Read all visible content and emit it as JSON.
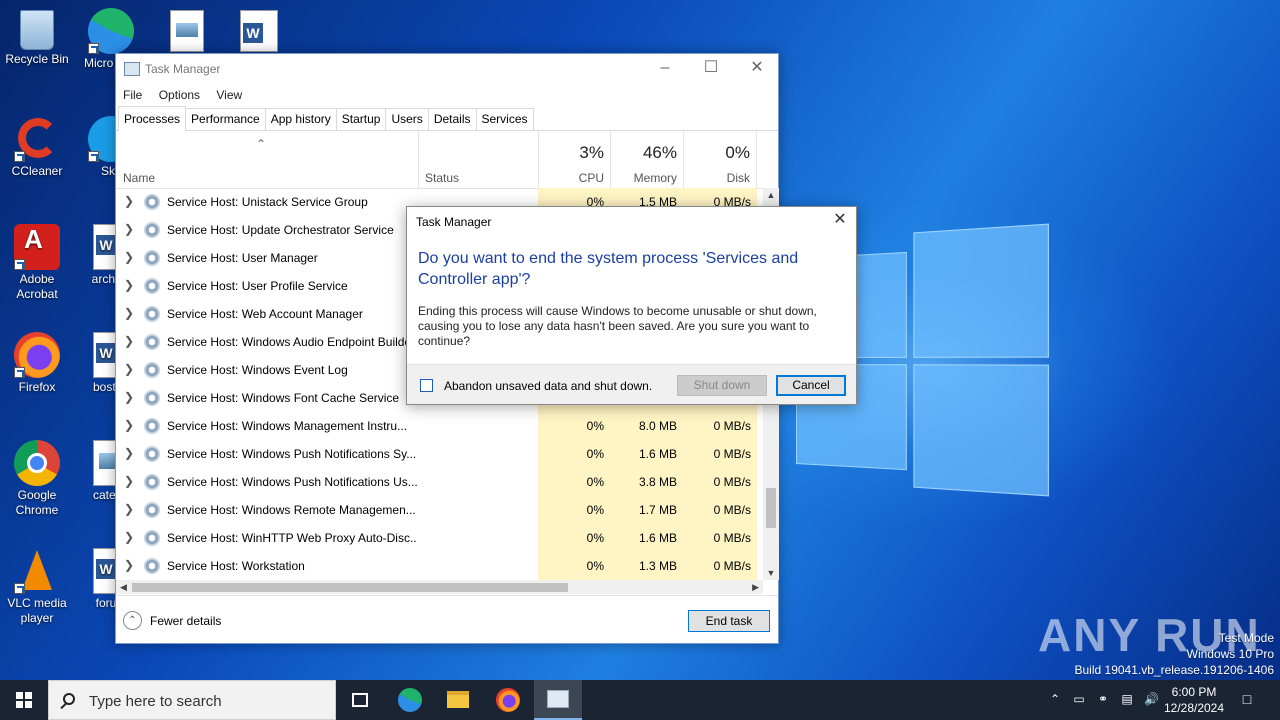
{
  "desktop": {
    "icons": [
      {
        "label": "Recycle Bin"
      },
      {
        "label": "Micro Edg"
      },
      {
        "label": "CCleaner"
      },
      {
        "label": "Sky"
      },
      {
        "label": "Adobe Acrobat"
      },
      {
        "label": "archive"
      },
      {
        "label": "Firefox"
      },
      {
        "label": "boston"
      },
      {
        "label": "Google Chrome"
      },
      {
        "label": "catego"
      },
      {
        "label": "VLC media player"
      },
      {
        "label": "forum"
      }
    ],
    "watermark": {
      "brand": "ANY RUN",
      "line1": "Test Mode",
      "line2": "Windows 10 Pro",
      "line3": "Build 19041.vb_release.191206-1406"
    }
  },
  "taskmanager": {
    "title": "Task Manager",
    "menu": [
      "File",
      "Options",
      "View"
    ],
    "tabs": [
      "Processes",
      "Performance",
      "App history",
      "Startup",
      "Users",
      "Details",
      "Services"
    ],
    "active_tab": "Processes",
    "columns": {
      "name": "Name",
      "status": "Status",
      "cpu": {
        "pct": "3%",
        "label": "CPU"
      },
      "memory": {
        "pct": "46%",
        "label": "Memory"
      },
      "disk": {
        "pct": "0%",
        "label": "Disk"
      }
    },
    "processes": [
      {
        "name": "Service Host: Unistack Service Group",
        "cpu": "0%",
        "mem": "1.5 MB",
        "disk": "0 MB/s"
      },
      {
        "name": "Service Host: Update Orchestrator Service",
        "cpu": "",
        "mem": "",
        "disk": ""
      },
      {
        "name": "Service Host: User Manager",
        "cpu": "",
        "mem": "",
        "disk": ""
      },
      {
        "name": "Service Host: User Profile Service",
        "cpu": "",
        "mem": "",
        "disk": ""
      },
      {
        "name": "Service Host: Web Account Manager",
        "cpu": "",
        "mem": "",
        "disk": ""
      },
      {
        "name": "Service Host: Windows Audio Endpoint Builder",
        "cpu": "",
        "mem": "",
        "disk": ""
      },
      {
        "name": "Service Host: Windows Event Log",
        "cpu": "",
        "mem": "",
        "disk": ""
      },
      {
        "name": "Service Host: Windows Font Cache Service",
        "cpu": "",
        "mem": "",
        "disk": ""
      },
      {
        "name": "Service Host: Windows Management Instru...",
        "cpu": "0%",
        "mem": "8.0 MB",
        "disk": "0 MB/s"
      },
      {
        "name": "Service Host: Windows Push Notifications Sy...",
        "cpu": "0%",
        "mem": "1.6 MB",
        "disk": "0 MB/s"
      },
      {
        "name": "Service Host: Windows Push Notifications Us...",
        "cpu": "0%",
        "mem": "3.8 MB",
        "disk": "0 MB/s"
      },
      {
        "name": "Service Host: Windows Remote Managemen...",
        "cpu": "0%",
        "mem": "1.7 MB",
        "disk": "0 MB/s"
      },
      {
        "name": "Service Host: WinHTTP Web Proxy Auto-Disc...",
        "cpu": "0%",
        "mem": "1.6 MB",
        "disk": "0 MB/s"
      },
      {
        "name": "Service Host: Workstation",
        "cpu": "0%",
        "mem": "1.3 MB",
        "disk": "0 MB/s"
      }
    ],
    "fewer_details": "Fewer details",
    "end_task": "End task"
  },
  "dialog": {
    "title": "Task Manager",
    "heading": "Do you want to end the system process 'Services and Controller app'?",
    "body": "Ending this process will cause Windows to become unusable or shut down, causing you to lose any data hasn't been saved. Are you sure you want to continue?",
    "checkbox_label": "Abandon unsaved data and shut down.",
    "shutdown_label": "Shut down",
    "cancel_label": "Cancel"
  },
  "taskbar": {
    "search_placeholder": "Type here to search",
    "time": "6:00 PM",
    "date": "12/28/2024"
  }
}
